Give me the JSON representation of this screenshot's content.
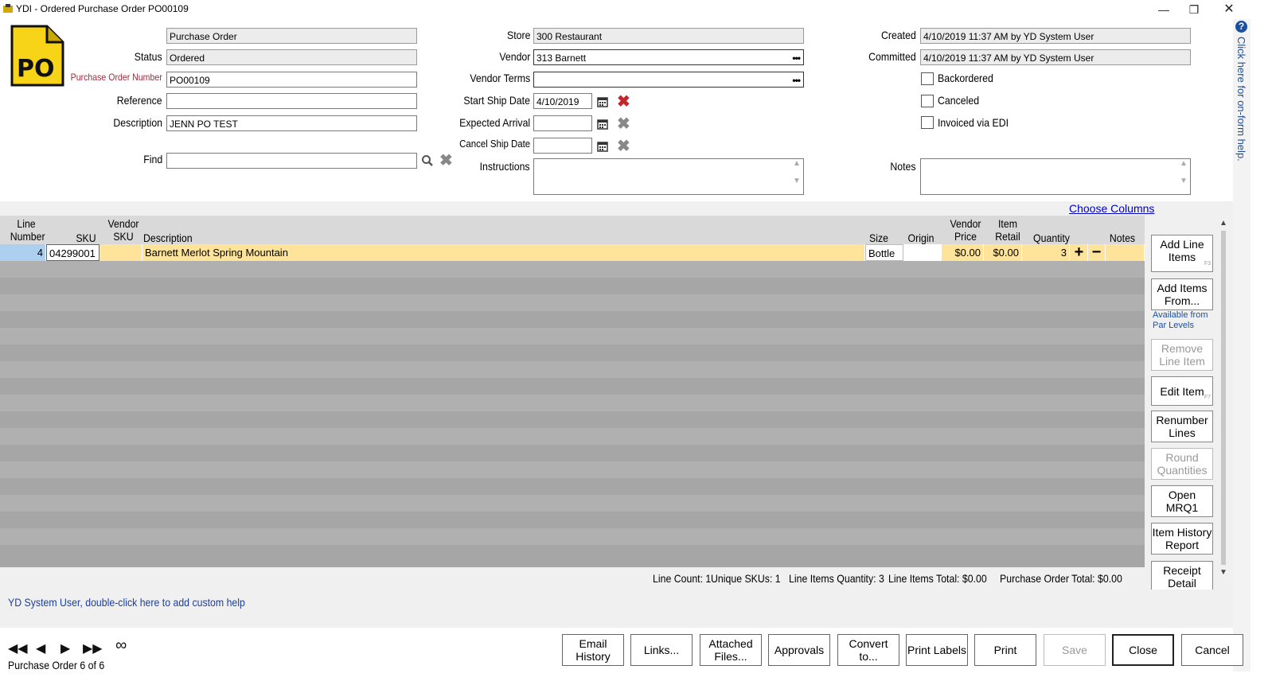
{
  "window": {
    "title": "YDI - Ordered Purchase Order PO00109"
  },
  "header": {
    "type_value": "Purchase Order",
    "status_label": "Status",
    "status_value": "Ordered",
    "po_number_label": "Purchase Order Number",
    "po_number_value": "PO00109",
    "reference_label": "Reference",
    "reference_value": "",
    "description_label": "Description",
    "description_value": "JENN PO TEST",
    "find_label": "Find",
    "find_value": "",
    "store_label": "Store",
    "store_value": "300 Restaurant",
    "vendor_label": "Vendor",
    "vendor_value": "313 Barnett",
    "vendor_terms_label": "Vendor Terms",
    "vendor_terms_value": "",
    "start_ship_label": "Start Ship Date",
    "start_ship_value": "4/10/2019",
    "expected_arrival_label": "Expected Arrival",
    "expected_arrival_value": "",
    "cancel_ship_label": "Cancel Ship Date",
    "cancel_ship_value": "",
    "instructions_label": "Instructions",
    "created_label": "Created",
    "created_value": "4/10/2019 11:37 AM by YD System User",
    "committed_label": "Committed",
    "committed_value": "4/10/2019 11:37 AM by YD System User",
    "backordered_label": "Backordered",
    "canceled_label": "Canceled",
    "invoiced_edi_label": "Invoiced via EDI",
    "notes_label": "Notes",
    "po_logo_text": "PO"
  },
  "grid": {
    "choose_columns": "Choose Columns",
    "columns": {
      "line1": "Line",
      "line2": "Number",
      "sku": "SKU",
      "vsku1": "Vendor",
      "vsku2": "SKU",
      "description": "Description",
      "size": "Size",
      "origin": "Origin",
      "vprice1": "Vendor",
      "vprice2": "Price",
      "iretail1": "Item",
      "iretail2": "Retail",
      "quantity": "Quantity",
      "notes": "Notes"
    },
    "rows": [
      {
        "line": "4",
        "sku": "04299001",
        "vendor_sku": "",
        "description": "Barnett Merlot Spring Mountain",
        "size": "Bottle",
        "origin": "",
        "vendor_price": "$0.00",
        "item_retail": "$0.00",
        "quantity": "3",
        "notes": ""
      }
    ]
  },
  "side_buttons": {
    "add_line_items": "Add Line Items",
    "add_line_items_key": "F3",
    "add_items_from": "Add Items From...",
    "available_par": "Available from Par Levels",
    "remove_line_item": "Remove Line Item",
    "edit_item": "Edit Item",
    "edit_item_key": "F7",
    "renumber_lines": "Renumber Lines",
    "round_quantities": "Round Quantities",
    "open_mrq1": "Open MRQ1",
    "item_history_report": "Item History Report",
    "receipt_detail": "Receipt Detail"
  },
  "summary": {
    "line_count": "Line Count: 1",
    "unique_skus": "Unique SKUs: 1",
    "line_items_qty": "Line Items Quantity: 3",
    "line_items_total": "Line Items Total: $0.00",
    "po_total": "Purchase Order Total: $0.00"
  },
  "custom_help": "YD System User, double-click here to add custom help",
  "side_help": "Click here for on-form help.",
  "footer": {
    "record_position": "Purchase Order 6 of 6",
    "buttons": {
      "email_history": "Email History",
      "links": "Links...",
      "attached_files": "Attached Files...",
      "approvals": "Approvals",
      "convert_to": "Convert to...",
      "print_labels": "Print Labels",
      "print": "Print",
      "save": "Save",
      "close": "Close",
      "cancel": "Cancel"
    }
  }
}
